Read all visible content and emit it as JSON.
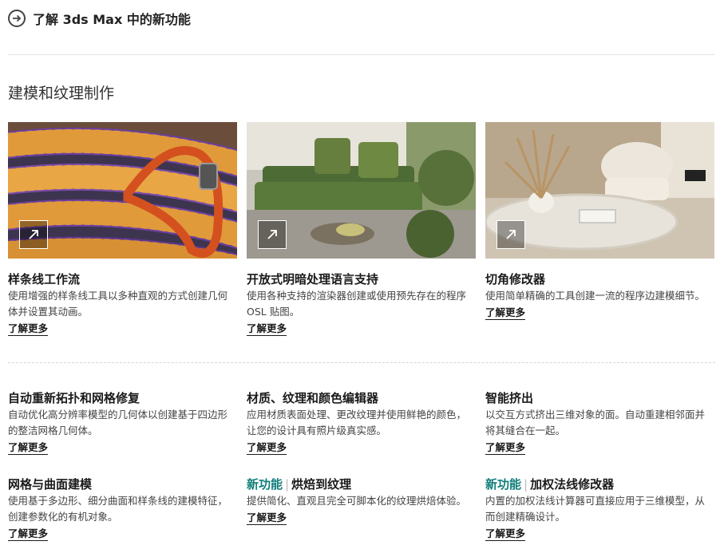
{
  "header": {
    "link_text": "了解 3ds Max 中的新功能"
  },
  "section": {
    "title": "建模和纹理制作"
  },
  "common": {
    "learn_more": "了解更多",
    "new_badge": "新功能"
  },
  "cards_top": [
    {
      "title": "样条线工作流",
      "desc": "使用增强的样条线工具以多种直观的方式创建几何体并设置其动画。"
    },
    {
      "title": "开放式明暗处理语言支持",
      "desc": "使用各种支持的渲染器创建或使用预先存在的程序 OSL 贴图。"
    },
    {
      "title": "切角修改器",
      "desc": "使用简单精确的工具创建一流的程序边建模细节。"
    }
  ],
  "cards_mid": [
    {
      "title": "自动重新拓扑和网格修复",
      "desc": "自动优化高分辨率模型的几何体以创建基于四边形的整洁网格几何体。"
    },
    {
      "title": "材质、纹理和颜色编辑器",
      "desc": "应用材质表面处理、更改纹理并使用鲜艳的颜色，让您的设计具有照片级真实感。"
    },
    {
      "title": "智能挤出",
      "desc": "以交互方式挤出三维对象的面。自动重建相邻面并将其缝合在一起。"
    }
  ],
  "cards_bottom": [
    {
      "title": "网格与曲面建模",
      "desc": "使用基于多边形、细分曲面和样条线的建模特征，创建参数化的有机对象。"
    },
    {
      "title": "烘焙到纹理",
      "desc": "提供简化、直观且完全可脚本化的纹理烘焙体验。"
    },
    {
      "title": "加权法线修改器",
      "desc": "内置的加权法线计算器可直接应用于三维模型，从而创建精确设计。"
    }
  ]
}
